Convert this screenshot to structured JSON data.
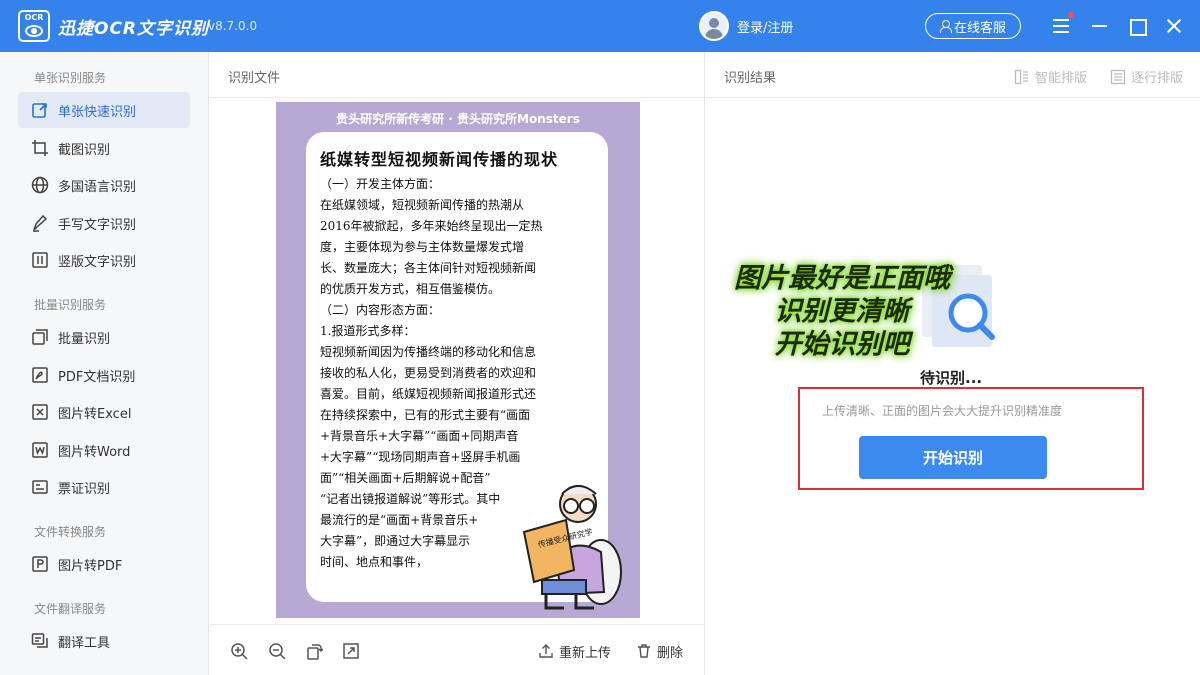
{
  "app": {
    "title": "迅捷OCR文字识别",
    "version": "v8.7.0.0",
    "logo_text": "OCR"
  },
  "header": {
    "login_label": "登录/注册",
    "service_label": "在线客服"
  },
  "sidebar": {
    "sections": [
      {
        "title": "单张识别服务",
        "items": [
          {
            "label": "单张快速识别",
            "icon": "quick-recognize-icon",
            "active": true
          },
          {
            "label": "截图识别",
            "icon": "crop-icon"
          },
          {
            "label": "多国语言识别",
            "icon": "globe-icon"
          },
          {
            "label": "手写文字识别",
            "icon": "pen-icon"
          },
          {
            "label": "竖版文字识别",
            "icon": "vertical-text-icon"
          }
        ]
      },
      {
        "title": "批量识别服务",
        "items": [
          {
            "label": "批量识别",
            "icon": "batch-icon"
          },
          {
            "label": "PDF文档识别",
            "icon": "pdf-icon"
          },
          {
            "label": "图片转Excel",
            "icon": "excel-icon"
          },
          {
            "label": "图片转Word",
            "icon": "word-icon"
          },
          {
            "label": "票证识别",
            "icon": "ticket-icon"
          }
        ]
      },
      {
        "title": "文件转换服务",
        "items": [
          {
            "label": "图片转PDF",
            "icon": "pdf-file-icon"
          }
        ]
      },
      {
        "title": "文件翻译服务",
        "items": [
          {
            "label": "翻译工具",
            "icon": "translate-icon"
          }
        ]
      }
    ]
  },
  "file_panel": {
    "title": "识别文件",
    "reupload_label": "重新上传",
    "delete_label": "删除",
    "document": {
      "header": "贵头研究所新传考研 · 贵头研究所Monsters",
      "title": "纸媒转型短视频新闻传播的现状",
      "lines": [
        "（一）开发主体方面：",
        "在纸媒领域，短视频新闻传播的热潮从",
        "2016年被掀起，多年来始终呈现出一定热",
        "度，主要体现为参与主体数量爆发式增",
        "长、数量庞大；各主体间针对短视频新闻",
        "的优质开发方式，相互借鉴模仿。",
        "（二）内容形态方面：",
        "1.报道形式多样：",
        "短视频新闻因为传播终端的移动化和信息",
        "接收的私人化，更易受到消费者的欢迎和",
        "喜爱。目前，纸媒短视频新闻报道形式还",
        "在持续探索中，已有的形式主要有“画面",
        "+背景音乐+大字幕”“画面+同期声音",
        "+大字幕”“现场同期声音+竖屏手机画",
        "面”“相关画面+后期解说+配音”",
        "“记者出镜报道解说”等形式。其中",
        "最流行的是“画面+背景音乐+",
        "大字幕”，即通过大字幕显示",
        "时间、地点和事件，"
      ],
      "sticker_text": "传播受众研究学"
    }
  },
  "result_panel": {
    "title": "识别结果",
    "smart_layout_label": "智能排版",
    "line_layout_label": "逐行排版",
    "pending_label": "待识别...",
    "hint": "上传清晰、正面的图片会大大提升识别精准度",
    "start_button": "开始识别"
  },
  "overlay_text": [
    "图片最好是正面哦",
    "识别更清晰",
    "开始识别吧"
  ],
  "colors": {
    "brand": "#3483ec",
    "button": "#3c8af0",
    "highlight_box": "#d9303a",
    "doc_bg": "#b7a9d3",
    "overlay_glow": "#8fe032"
  }
}
